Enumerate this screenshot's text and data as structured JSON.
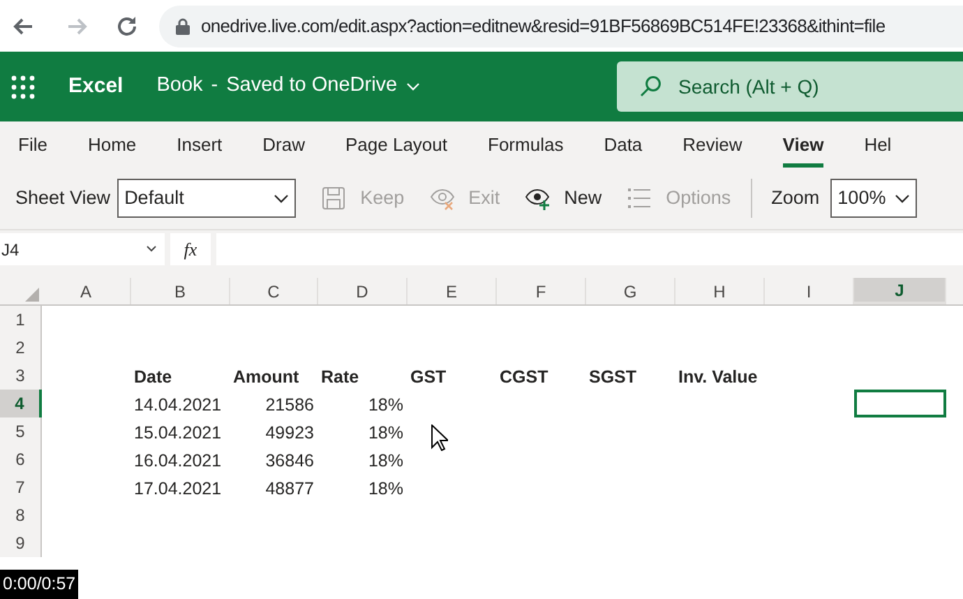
{
  "browser": {
    "url": "onedrive.live.com/edit.aspx?action=editnew&resid=91BF56869BC514FE!23368&ithint=file"
  },
  "app_header": {
    "app_name": "Excel",
    "document": "Book",
    "separator": "-",
    "save_status": "Saved to OneDrive",
    "search": {
      "placeholder": "Search (Alt + Q)"
    }
  },
  "ribbon_tabs": [
    {
      "label": "File",
      "selected": false
    },
    {
      "label": "Home",
      "selected": false
    },
    {
      "label": "Insert",
      "selected": false
    },
    {
      "label": "Draw",
      "selected": false
    },
    {
      "label": "Page Layout",
      "selected": false
    },
    {
      "label": "Formulas",
      "selected": false
    },
    {
      "label": "Data",
      "selected": false
    },
    {
      "label": "Review",
      "selected": false
    },
    {
      "label": "View",
      "selected": true
    },
    {
      "label": "Hel",
      "selected": false
    }
  ],
  "toolbar": {
    "sheet_view_label": "Sheet View",
    "sheet_view_value": "Default",
    "buttons": [
      {
        "kind": "keep",
        "label": "Keep",
        "disabled": true
      },
      {
        "kind": "exit",
        "label": "Exit",
        "disabled": true
      },
      {
        "kind": "new",
        "label": "New",
        "disabled": false
      },
      {
        "kind": "options",
        "label": "Options",
        "disabled": true
      }
    ],
    "zoom_label": "Zoom",
    "zoom_value": "100%"
  },
  "formula_bar": {
    "name_box": "J4",
    "function_symbol": "fx"
  },
  "sheet": {
    "columns": [
      {
        "label": "A",
        "selected": false
      },
      {
        "label": "B",
        "selected": false
      },
      {
        "label": "C",
        "selected": false
      },
      {
        "label": "D",
        "selected": false
      },
      {
        "label": "E",
        "selected": false
      },
      {
        "label": "F",
        "selected": false
      },
      {
        "label": "G",
        "selected": false
      },
      {
        "label": "H",
        "selected": false
      },
      {
        "label": "I",
        "selected": false
      },
      {
        "label": "J",
        "selected": true
      }
    ],
    "rows": [
      {
        "label": "1",
        "selected": false
      },
      {
        "label": "2",
        "selected": false
      },
      {
        "label": "3",
        "selected": false,
        "cells": [
          null,
          {
            "text": "Date",
            "kind": "text"
          },
          {
            "text": "Amount",
            "kind": "text"
          },
          {
            "text": "Rate",
            "kind": "text"
          },
          {
            "text": "GST",
            "kind": "text"
          },
          {
            "text": "CGST",
            "kind": "text"
          },
          {
            "text": "SGST",
            "kind": "text"
          },
          {
            "text": "Inv. Value",
            "kind": "text"
          }
        ]
      },
      {
        "label": "4",
        "selected": true,
        "cells": [
          null,
          {
            "text": "14.04.2021",
            "kind": "text"
          },
          {
            "text": "21586",
            "kind": "number"
          },
          {
            "text": "18%",
            "kind": "number"
          }
        ]
      },
      {
        "label": "5",
        "selected": false,
        "cells": [
          null,
          {
            "text": "15.04.2021",
            "kind": "text"
          },
          {
            "text": "49923",
            "kind": "number"
          },
          {
            "text": "18%",
            "kind": "number"
          }
        ]
      },
      {
        "label": "6",
        "selected": false,
        "cells": [
          null,
          {
            "text": "16.04.2021",
            "kind": "text"
          },
          {
            "text": "36846",
            "kind": "number"
          },
          {
            "text": "18%",
            "kind": "number"
          }
        ]
      },
      {
        "label": "7",
        "selected": false,
        "cells": [
          null,
          {
            "text": "17.04.2021",
            "kind": "text"
          },
          {
            "text": "48877",
            "kind": "number"
          },
          {
            "text": "18%",
            "kind": "number"
          }
        ]
      },
      {
        "label": "8",
        "selected": false
      },
      {
        "label": "9",
        "selected": false
      }
    ]
  },
  "video_overlay": {
    "time": "0:00/0:57"
  }
}
